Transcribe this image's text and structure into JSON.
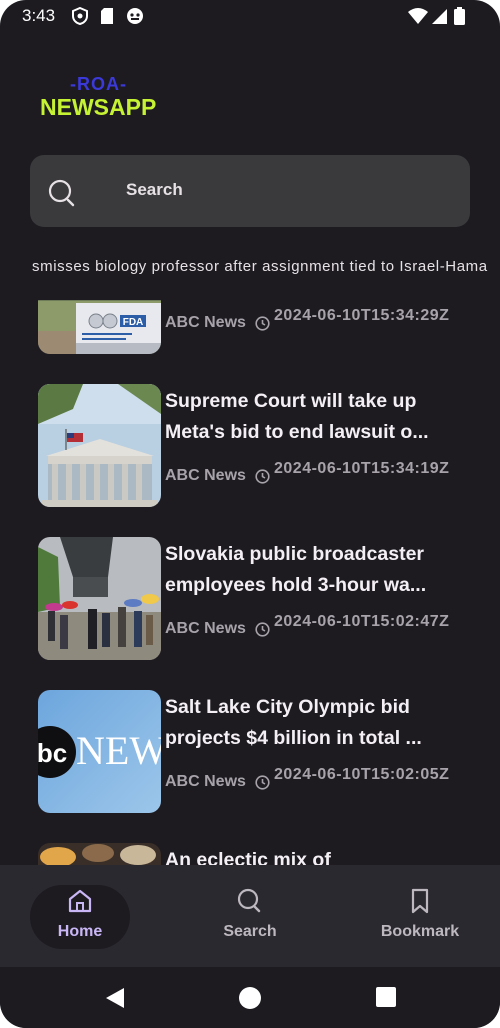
{
  "status_bar": {
    "time": "3:43"
  },
  "logo": {
    "top": "-ROA-",
    "bottom": "NEWSAPP"
  },
  "search": {
    "placeholder": "Search"
  },
  "ticker": {
    "text": "smisses biology professor after assignment tied to Israel-Hama"
  },
  "articles": [
    {
      "title_line1": "",
      "title_line2": "",
      "source": "ABC News",
      "date": "2024-06-10T15:34:29Z"
    },
    {
      "title_line1": "Supreme Court will take up",
      "title_line2": "Meta's bid to end lawsuit o...",
      "source": "ABC News",
      "date": "2024-06-10T15:34:19Z"
    },
    {
      "title_line1": "Slovakia public broadcaster",
      "title_line2": "employees hold 3-hour wa...",
      "source": "ABC News",
      "date": "2024-06-10T15:02:47Z"
    },
    {
      "title_line1": "Salt Lake City Olympic bid",
      "title_line2": "projects $4 billion in total ...",
      "source": "ABC News",
      "date": "2024-06-10T15:02:05Z"
    },
    {
      "title_line1": "An eclectic mix of",
      "title_line2": "",
      "source": "",
      "date": ""
    }
  ],
  "thumb_text": {
    "fda": "FDA",
    "abc_logo": "bc",
    "news": "NEW"
  },
  "bottom_nav": {
    "home": "Home",
    "search": "Search",
    "bookmark": "Bookmark"
  },
  "colors": {
    "accent": "#c9b6f5",
    "background": "#1d1b20",
    "logo_green": "#c5f232",
    "logo_blue": "#3b39d8"
  }
}
